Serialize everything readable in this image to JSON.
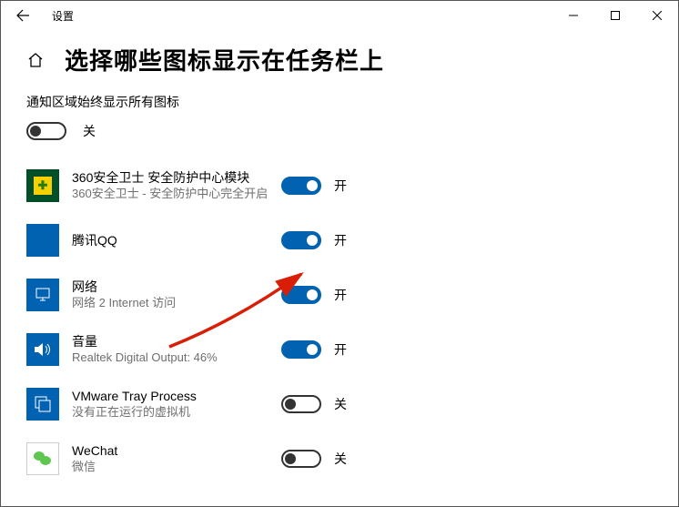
{
  "window": {
    "app_title": "设置"
  },
  "page": {
    "title": "选择哪些图标显示在任务栏上",
    "section_label": "通知区域始终显示所有图标"
  },
  "labels": {
    "on": "开",
    "off": "关"
  },
  "master": {
    "state": "off"
  },
  "items": [
    {
      "icon": "360",
      "title": "360安全卫士 安全防护中心模块",
      "subtitle": "360安全卫士 - 安全防护中心完全开启",
      "state": "on"
    },
    {
      "icon": "qq",
      "title": "腾讯QQ",
      "subtitle": "",
      "state": "on"
    },
    {
      "icon": "network",
      "title": "网络",
      "subtitle": "网络 2 Internet 访问",
      "state": "on"
    },
    {
      "icon": "volume",
      "title": "音量",
      "subtitle": "Realtek Digital Output: 46%",
      "state": "on"
    },
    {
      "icon": "vmware",
      "title": "VMware Tray Process",
      "subtitle": "没有正在运行的虚拟机",
      "state": "off"
    },
    {
      "icon": "wechat",
      "title": "WeChat",
      "subtitle": "微信",
      "state": "off"
    }
  ]
}
